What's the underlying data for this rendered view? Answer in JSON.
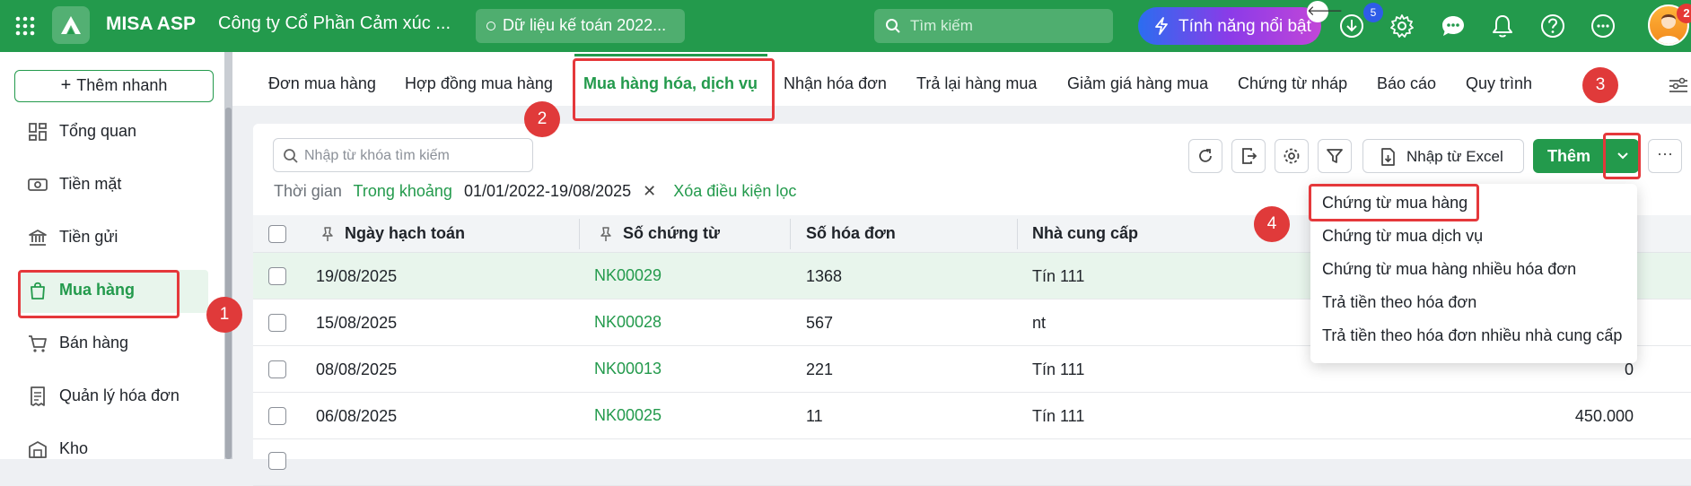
{
  "topbar": {
    "app_name": "MISA ASP",
    "company": "Công ty Cổ Phần Cảm xúc ...",
    "dataset": "Dữ liệu kế toán 2022...",
    "search_placeholder": "Tìm kiếm",
    "feature_button": "Tính năng nổi bật",
    "back_arrow": "🡐",
    "download_badge": "5",
    "avatar_badge": "2",
    "brand_color": "#239a4c"
  },
  "sidebar": {
    "add_quick": "Thêm nhanh",
    "items": [
      {
        "label": "Tổng quan",
        "icon": "dashboard-icon"
      },
      {
        "label": "Tiền mặt",
        "icon": "cash-icon"
      },
      {
        "label": "Tiền gửi",
        "icon": "bank-icon"
      },
      {
        "label": "Mua hàng",
        "icon": "shopping-bag-icon"
      },
      {
        "label": "Bán hàng",
        "icon": "cart-icon"
      },
      {
        "label": "Quản lý hóa đơn",
        "icon": "invoice-icon"
      },
      {
        "label": "Kho",
        "icon": "warehouse-icon"
      }
    ]
  },
  "tabs": [
    "Đơn mua hàng",
    "Hợp đồng mua hàng",
    "Mua hàng hóa, dịch vụ",
    "Nhận hóa đơn",
    "Trả lại hàng mua",
    "Giảm giá hàng mua",
    "Chứng từ nháp",
    "Báo cáo",
    "Quy trình"
  ],
  "toolbar": {
    "search_placeholder": "Nhập từ khóa tìm kiếm",
    "excel_label": "Nhập từ Excel",
    "add_label": "Thêm",
    "more_label": "···"
  },
  "filter": {
    "label": "Thời gian",
    "mode": "Trong khoảng",
    "range": "01/01/2022-19/08/2025",
    "remove": "✕",
    "clear": "Xóa điều kiện lọc"
  },
  "table": {
    "headers": [
      "Ngày hạch toán",
      "Số chứng từ",
      "Số hóa đơn",
      "Nhà cung cấp"
    ],
    "rows": [
      {
        "date": "19/08/2025",
        "doc": "NK00029",
        "invoice": "1368",
        "supplier": "Tín 111",
        "amount": ""
      },
      {
        "date": "15/08/2025",
        "doc": "NK00028",
        "invoice": "567",
        "supplier": "nt",
        "amount": ""
      },
      {
        "date": "08/08/2025",
        "doc": "NK00013",
        "invoice": "221",
        "supplier": "Tín 111",
        "amount": "0"
      },
      {
        "date": "06/08/2025",
        "doc": "NK00025",
        "invoice": "11",
        "supplier": "Tín 111",
        "amount": "450.000"
      }
    ]
  },
  "dropdown": {
    "items": [
      "Chứng từ mua hàng",
      "Chứng từ mua dịch vụ",
      "Chứng từ mua hàng nhiều hóa đơn",
      "Trả tiền theo hóa đơn",
      "Trả tiền theo hóa đơn nhiều nhà cung cấp"
    ]
  },
  "steps": [
    "1",
    "2",
    "3",
    "4"
  ]
}
